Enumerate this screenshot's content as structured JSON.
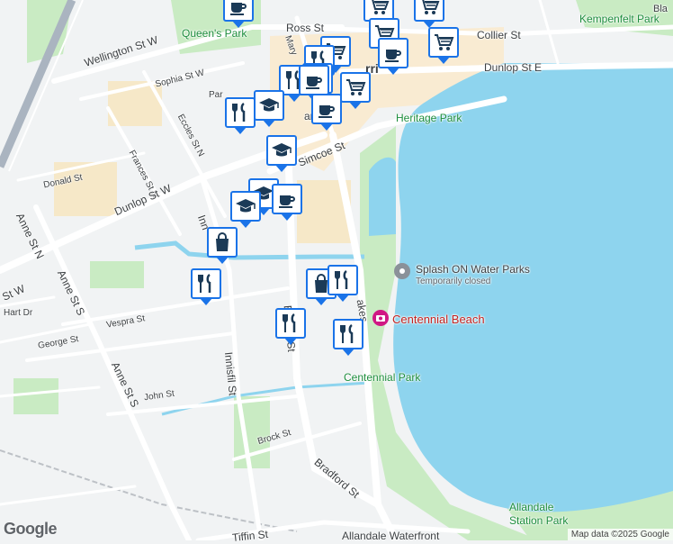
{
  "colors": {
    "water": "#8ed4ee",
    "land": "#f1f3f4",
    "park": "#c9ebc3",
    "road": "#ffffff",
    "highway": "#aab4c0",
    "pin_border": "#1a73e8",
    "downtown": "#fbe9c9"
  },
  "streets": {
    "ross_st": "Ross St",
    "collier_st": "Collier St",
    "dunlop_st_e": "Dunlop St E",
    "wellington_st_w": "Wellington St W",
    "sophia_st_w": "Sophia St W",
    "eccles_st_n": "Eccles St N",
    "frances_st_n": "Frances St N",
    "donald_st": "Donald St",
    "dunlop_st_w": "Dunlop St W",
    "simcoe_st": "Simcoe St",
    "anne_st_n": "Anne St N",
    "anne_st_s_upper": "Anne St S",
    "anne_st_s_lower": "Anne St S",
    "st_w": "St W",
    "hart_dr": "Hart Dr",
    "george_st": "George St",
    "vespra_st": "Vespra St",
    "john_st": "John St",
    "innisfil_st": "Innisfil St",
    "brock_st": "Brock St",
    "bradford_st": "Bradford St",
    "tiffin_st": "Tiffin St",
    "allandale_waterfront": "Allandale Waterfront",
    "mary_st": "Mary",
    "bra_st": "Br",
    "st_frag": "St",
    "lakes": "akes",
    "par": "Par",
    "ham": "am",
    "ri": "rri",
    "inn": "Inn",
    "bla": "Bla"
  },
  "places": {
    "queens_park": "Queen's Park",
    "kempenfelt_park": "Kempenfelt Park",
    "heritage_park": "Heritage Park",
    "splash_on": "Splash ON Water Parks",
    "splash_on_status": "Temporarily closed",
    "centennial_beach": "Centennial Beach",
    "centennial_park": "Centennial Park",
    "allandale_station_park_1": "Allandale",
    "allandale_station_park_2": "Station Park"
  },
  "footer": {
    "logo": "Google",
    "attribution": "Map data ©2025 Google"
  },
  "pins": [
    {
      "icon": "coffee-icon"
    },
    {
      "icon": "shopping-cart-icon"
    },
    {
      "icon": "shopping-cart-icon"
    },
    {
      "icon": "shopping-cart-icon"
    },
    {
      "icon": "shopping-cart-icon"
    },
    {
      "icon": "coffee-icon"
    },
    {
      "icon": "shopping-cart-icon"
    },
    {
      "icon": "restaurant-icon"
    },
    {
      "icon": "coffee-icon"
    },
    {
      "icon": "restaurant-icon"
    },
    {
      "icon": "coffee-icon"
    },
    {
      "icon": "shopping-cart-icon"
    },
    {
      "icon": "restaurant-icon"
    },
    {
      "icon": "school-icon"
    },
    {
      "icon": "coffee-icon"
    },
    {
      "icon": "school-icon"
    },
    {
      "icon": "school-icon"
    },
    {
      "icon": "school-icon"
    },
    {
      "icon": "coffee-icon"
    },
    {
      "icon": "shopping-bag-icon"
    },
    {
      "icon": "restaurant-icon"
    },
    {
      "icon": "restaurant-icon"
    },
    {
      "icon": "shopping-bag-icon"
    },
    {
      "icon": "restaurant-icon"
    },
    {
      "icon": "restaurant-icon"
    }
  ]
}
